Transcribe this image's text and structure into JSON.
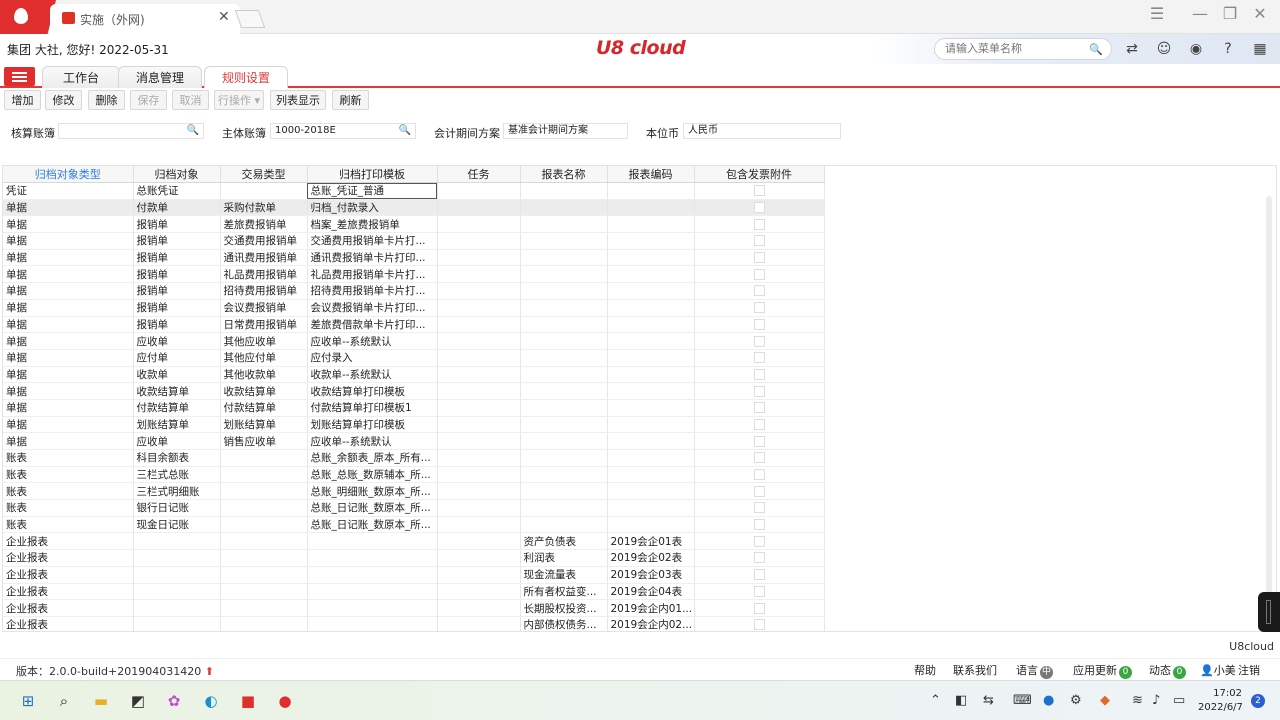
{
  "browser": {
    "tab_title": "实施（外网)",
    "close_symbol": "✕"
  },
  "header": {
    "greeting": "集团 大社, 您好! 2022-05-31",
    "logo_text": "U8 cloud",
    "search_placeholder": "请输入菜单名称"
  },
  "module_tabs": [
    {
      "label": "工作台"
    },
    {
      "label": "消息管理"
    },
    {
      "label": "规则设置"
    }
  ],
  "toolbar": {
    "add": "增加",
    "edit": "修改",
    "delete": "删除",
    "save": "保存",
    "cancel": "取消",
    "row_ops": "行操作",
    "list_view": "列表显示",
    "refresh": "刷新"
  },
  "filters": {
    "ledger_label": "核算账簿",
    "ledger_value": "",
    "main_ledger_label": "主体账簿",
    "main_ledger_value": "1000-2018E",
    "period_label": "会计期间方案",
    "period_value": "基准会计期间方案",
    "currency_label": "本位币",
    "currency_value": "人民币"
  },
  "grid": {
    "columns": [
      "归档对象类型",
      "归档对象",
      "交易类型",
      "归档打印模板",
      "任务",
      "报表名称",
      "报表编码",
      "包含发票附件"
    ],
    "rows": [
      [
        "凭证",
        "总账凭证",
        "",
        "总账_凭证_普通",
        "",
        "",
        ""
      ],
      [
        "单据",
        "付款单",
        "采购付款单",
        "归档_付款录入",
        "",
        "",
        ""
      ],
      [
        "单据",
        "报销单",
        "差旅费报销单",
        "档案_差旅费报销单",
        "",
        "",
        ""
      ],
      [
        "单据",
        "报销单",
        "交通费用报销单",
        "交通费用报销单卡片打...",
        "",
        "",
        ""
      ],
      [
        "单据",
        "报销单",
        "通讯费用报销单",
        "通讯费报销单卡片打印...",
        "",
        "",
        ""
      ],
      [
        "单据",
        "报销单",
        "礼品费用报销单",
        "礼品费用报销单卡片打...",
        "",
        "",
        ""
      ],
      [
        "单据",
        "报销单",
        "招待费用报销单",
        "招待费用报销单卡片打...",
        "",
        "",
        ""
      ],
      [
        "单据",
        "报销单",
        "会议费报销单",
        "会议费报销单卡片打印...",
        "",
        "",
        ""
      ],
      [
        "单据",
        "报销单",
        "日常费用报销单",
        "差旅费借款单卡片打印...",
        "",
        "",
        ""
      ],
      [
        "单据",
        "应收单",
        "其他应收单",
        "应收单--系统默认",
        "",
        "",
        ""
      ],
      [
        "单据",
        "应付单",
        "其他应付单",
        "应付录入",
        "",
        "",
        ""
      ],
      [
        "单据",
        "收款单",
        "其他收款单",
        "收款单--系统默认",
        "",
        "",
        ""
      ],
      [
        "单据",
        "收款结算单",
        "收款结算单",
        "收款结算单打印模板",
        "",
        "",
        ""
      ],
      [
        "单据",
        "付款结算单",
        "付款结算单",
        "付款结算单打印模板1",
        "",
        "",
        ""
      ],
      [
        "单据",
        "划账结算单",
        "划账结算单",
        "划账结算单打印模板",
        "",
        "",
        ""
      ],
      [
        "单据",
        "应收单",
        "销售应收单",
        "应收单--系统默认",
        "",
        "",
        ""
      ],
      [
        "账表",
        "科目余额表",
        "",
        "总账_余额表_原本_所有...",
        "",
        "",
        ""
      ],
      [
        "账表",
        "三栏式总账",
        "",
        "总账_总账_数原辅本_所...",
        "",
        "",
        ""
      ],
      [
        "账表",
        "三栏式明细账",
        "",
        "总账_明细账_数原本_所...",
        "",
        "",
        ""
      ],
      [
        "账表",
        "银行日记账",
        "",
        "总账_日记账_数原本_所...",
        "",
        "",
        ""
      ],
      [
        "账表",
        "现金日记账",
        "",
        "总账_日记账_数原本_所...",
        "",
        "",
        ""
      ],
      [
        "企业报表",
        "",
        "",
        "",
        "",
        "资产负债表",
        "2019会企01表"
      ],
      [
        "企业报表",
        "",
        "",
        "",
        "",
        "利润表",
        "2019会企02表"
      ],
      [
        "企业报表",
        "",
        "",
        "",
        "",
        "现金流量表",
        "2019会企03表"
      ],
      [
        "企业报表",
        "",
        "",
        "",
        "",
        "所有者权益变...",
        "2019会企04表"
      ],
      [
        "企业报表",
        "",
        "",
        "",
        "",
        "长期股权投资...",
        "2019会企内01..."
      ],
      [
        "企业报表",
        "",
        "",
        "",
        "",
        "内部债权债务...",
        "2019会企内02..."
      ]
    ]
  },
  "brand_tag": "U8cloud",
  "status": {
    "version": "版本：2.0.0-build+201904031420",
    "help": "帮助",
    "contact": "联系我们",
    "language": "语言",
    "app_update": "应用更新",
    "app_update_count": "0",
    "activity": "动态",
    "activity_count": "0",
    "user": "小美",
    "logout": "注销"
  },
  "taskbar": {
    "time": "17:02",
    "date": "2022/6/7",
    "notification_count": "2"
  },
  "colors": {
    "brand_red": "#e02d2d",
    "header_link": "#2a7de1",
    "badge_green": "#3aa640"
  }
}
